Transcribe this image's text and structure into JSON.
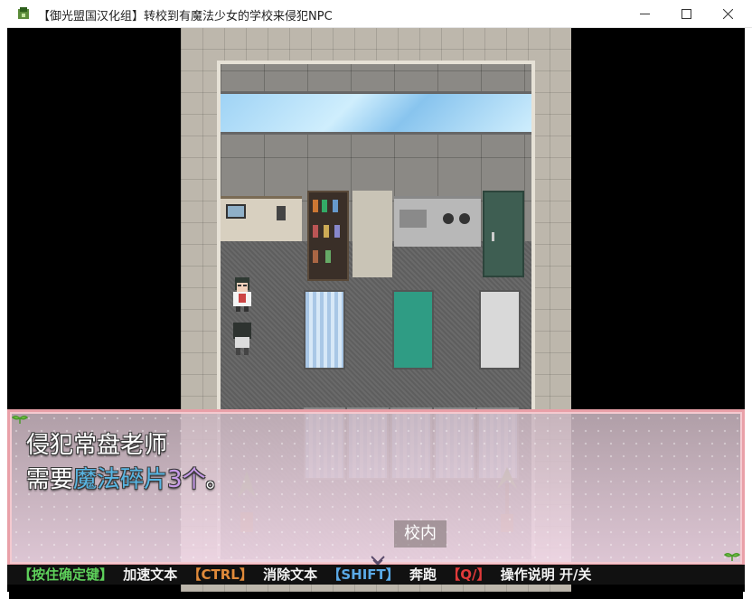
{
  "window": {
    "title": "【御光盟国汉化组】转校到有魔法少女的学校来侵犯NPC",
    "minimize_symbol": "—",
    "maximize_symbol": "☐",
    "close_symbol": "✕"
  },
  "dialog": {
    "line1": "侵犯常盘老师",
    "line2_prefix": "需要",
    "line2_item": "魔法碎片",
    "line2_count": "3个",
    "line2_suffix": "。",
    "location": "校内",
    "item_color": "#58b6e4",
    "count_color": "#c79ae8"
  },
  "helpbar": [
    {
      "text": "【按住确定键】",
      "color": "#5ed15b"
    },
    {
      "text": "加速文本",
      "color": "#f2f2f2"
    },
    {
      "text": "【CTRL】",
      "color": "#e08a3a"
    },
    {
      "text": "消除文本",
      "color": "#f2f2f2"
    },
    {
      "text": "【SHIFT】",
      "color": "#5aa9e6"
    },
    {
      "text": "奔跑",
      "color": "#f2f2f2"
    },
    {
      "text": "【Q/】",
      "color": "#e03a3a"
    },
    {
      "text": "操作说明 开/关",
      "color": "#f2f2f2"
    }
  ],
  "icons": {
    "app": "app-icon",
    "sprout": "sprout-icon",
    "continue": "continue-arrow-icon"
  }
}
